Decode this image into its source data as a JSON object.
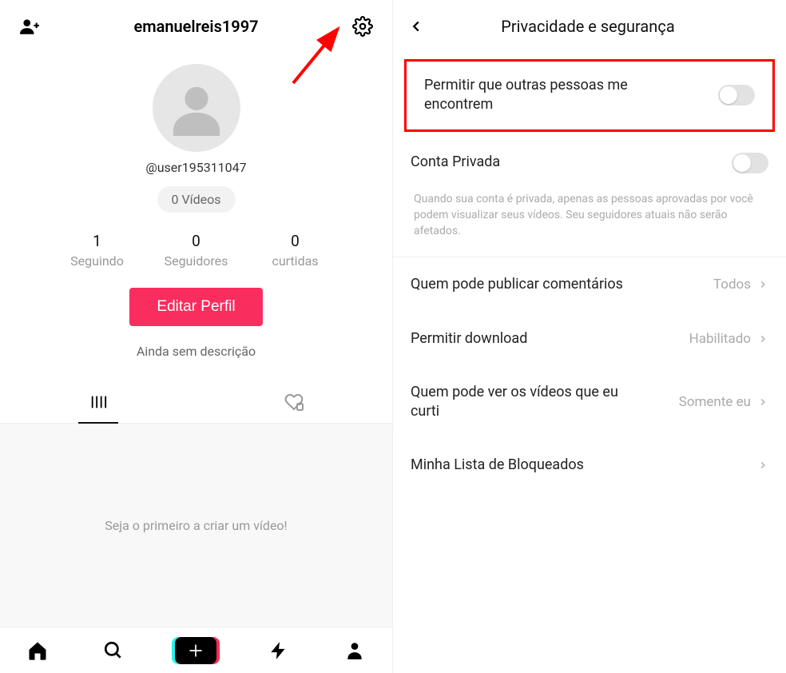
{
  "left_screen": {
    "header": {
      "username": "emanuelreis1997"
    },
    "profile": {
      "handle": "@user195311047",
      "videos_pill": "0 Vídeos",
      "stats": [
        {
          "count": "1",
          "label": "Seguindo"
        },
        {
          "count": "0",
          "label": "Seguidores"
        },
        {
          "count": "0",
          "label": "curtidas"
        }
      ],
      "edit_button": "Editar Perfil",
      "no_description": "Ainda sem descrição",
      "empty_message": "Seja o primeiro a criar um vídeo!"
    }
  },
  "right_screen": {
    "header_title": "Privacidade e segurança",
    "toggles": {
      "find_me": {
        "label": "Permitir que outras pessoas me encontrem",
        "on": false
      },
      "private_account": {
        "label": "Conta Privada",
        "on": false
      }
    },
    "private_account_subtext": "Quando sua conta é privada, apenas as pessoas aprovadas por você podem visualizar seus vídeos. Seu seguidores atuais não serão afetados.",
    "rows": {
      "comments": {
        "label": "Quem pode publicar comentários",
        "value": "Todos"
      },
      "download": {
        "label": "Permitir download",
        "value": "Habilitado"
      },
      "liked_videos": {
        "label": "Quem pode ver os vídeos que eu curti",
        "value": "Somente eu"
      },
      "blocked": {
        "label": "Minha Lista de Bloqueados",
        "value": ""
      }
    }
  }
}
